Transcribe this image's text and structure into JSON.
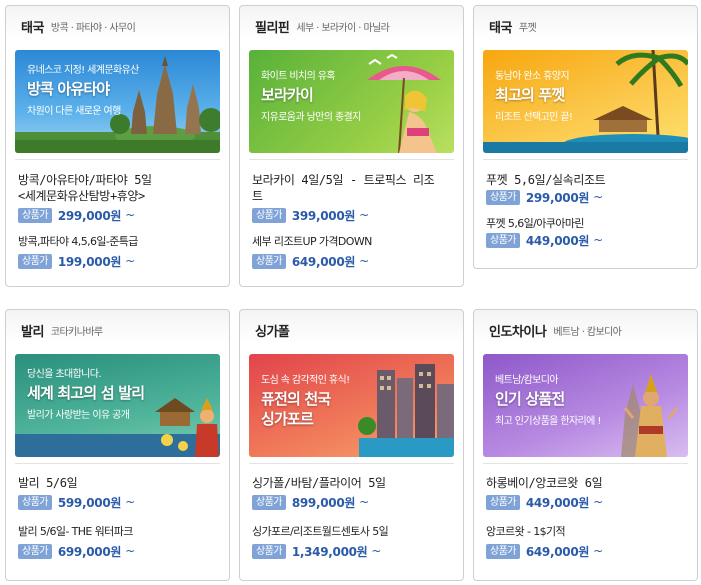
{
  "cards": [
    {
      "region": "태국",
      "cities": "방콕 · 파타야 · 사무이",
      "banner": {
        "tag": "유네스코 지정! 세계문화유산",
        "headline": "방콕 아유타야",
        "headline2": "",
        "sub": "차원이 다른 새로운 여행"
      },
      "products": [
        {
          "name": "방콕/아유타야/파타야 5일",
          "name2": "<세계문화유산탐방+휴양>",
          "badge": "상품가",
          "price": "299,000원",
          "tilde": "~"
        },
        {
          "name": "방콕,파타야 4,5,6일-준특급",
          "name2": "",
          "badge": "상품가",
          "price": "199,000원",
          "tilde": "~"
        }
      ]
    },
    {
      "region": "필리핀",
      "cities": "세부 · 보라카이 · 마닐라",
      "banner": {
        "tag": "화이트 비치의 유혹",
        "headline": "보라카이",
        "headline2": "",
        "sub": "지유로움과 낭만의 종결지"
      },
      "products": [
        {
          "name": "보라카이 4일/5일 - 트로픽스 리조",
          "name2": "트",
          "badge": "상품가",
          "price": "399,000원",
          "tilde": "~"
        },
        {
          "name": "세부 리조트UP 가격DOWN",
          "name2": "",
          "badge": "상품가",
          "price": "649,000원",
          "tilde": "~"
        }
      ]
    },
    {
      "region": "태국",
      "cities": "푸껫",
      "banner": {
        "tag": "동남아 완소 휴양지",
        "headline": "최고의 푸껫",
        "headline2": "",
        "sub": "리조트 선택고민 끝!"
      },
      "products": [
        {
          "name": "푸껫 5,6일/실속리조트",
          "name2": "",
          "badge": "상품가",
          "price": "299,000원",
          "tilde": "~"
        },
        {
          "name": "푸껫 5,6일/아쿠아마린",
          "name2": "",
          "badge": "상품가",
          "price": "449,000원",
          "tilde": "~"
        }
      ]
    },
    {
      "region": "발리",
      "cities": "코타키나바루",
      "banner": {
        "tag": "당신을 초대합니다.",
        "headline": "세계 최고의 섬 발리",
        "headline2": "",
        "sub": "발리가 사랑받는 이유 공개"
      },
      "products": [
        {
          "name": "발리 5/6일",
          "name2": "",
          "badge": "상품가",
          "price": "599,000원",
          "tilde": "~"
        },
        {
          "name": "발리 5/6일- THE 워터파크",
          "name2": "",
          "badge": "상품가",
          "price": "699,000원",
          "tilde": "~"
        }
      ]
    },
    {
      "region": "싱가폴",
      "cities": "",
      "banner": {
        "tag": "도심 속 감각적인 휴식!",
        "headline": "퓨전의 천국",
        "headline2": "싱가포르",
        "sub": ""
      },
      "products": [
        {
          "name": "싱가폴/바탐/플라이어 5일",
          "name2": "",
          "badge": "상품가",
          "price": "899,000원",
          "tilde": "~"
        },
        {
          "name": "싱가포르/리조트월드센토사 5일",
          "name2": "",
          "badge": "상품가",
          "price": "1,349,000원",
          "tilde": "~"
        }
      ]
    },
    {
      "region": "인도차이나",
      "cities": "베트남 · 캄보디아",
      "banner": {
        "tag": "베트남/캄보디아",
        "headline": "인기 상품전",
        "headline2": "",
        "sub": "최고 인기상품을 한자리에 !"
      },
      "products": [
        {
          "name": "하롱베이/앙코르왓 6일",
          "name2": "",
          "badge": "상품가",
          "price": "449,000원",
          "tilde": "~"
        },
        {
          "name": "앙코르왓 - 1$기적",
          "name2": "",
          "badge": "상품가",
          "price": "649,000원",
          "tilde": "~"
        }
      ]
    }
  ],
  "colors": {
    "badge": "#7fa3d6",
    "price": "#2a5aa8",
    "border": "#cfcfcf"
  }
}
